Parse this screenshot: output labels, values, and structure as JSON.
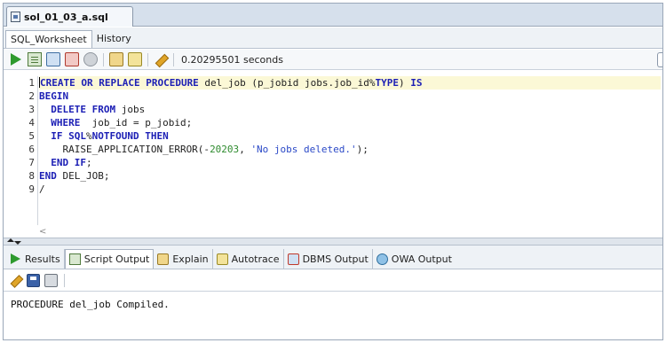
{
  "file_tab": {
    "title": "sol_01_03_a.sql",
    "icon": "sql-file-icon"
  },
  "sub_tabs": [
    {
      "label": "SQL_Worksheet",
      "active": true
    },
    {
      "label": "History",
      "active": false
    }
  ],
  "toolbar": {
    "icons": [
      "run-statement-icon",
      "run-script-icon",
      "commit-icon",
      "rollback-icon",
      "cancel-icon",
      "explain-plan-icon",
      "autotrace-icon",
      "clear-icon"
    ],
    "elapsed_time": "0.20295501 seconds"
  },
  "editor": {
    "line_numbers": [
      "1",
      "2",
      "3",
      "4",
      "5",
      "6",
      "7",
      "8",
      "9"
    ]
  },
  "output_tabs": [
    {
      "label": "Results",
      "icon": "results-icon",
      "active": false
    },
    {
      "label": "Script Output",
      "icon": "script-output-icon",
      "active": true
    },
    {
      "label": "Explain",
      "icon": "explain-icon",
      "active": false
    },
    {
      "label": "Autotrace",
      "icon": "autotrace-icon",
      "active": false
    },
    {
      "label": "DBMS Output",
      "icon": "dbms-output-icon",
      "active": false
    },
    {
      "label": "OWA Output",
      "icon": "owa-output-icon",
      "active": false
    }
  ],
  "output": {
    "text": "PROCEDURE del_job Compiled."
  },
  "colors": {
    "keyword": "#1c1fb5",
    "number": "#2e8b2e",
    "string": "#2b49c7",
    "current_line": "#fbf8d6"
  }
}
